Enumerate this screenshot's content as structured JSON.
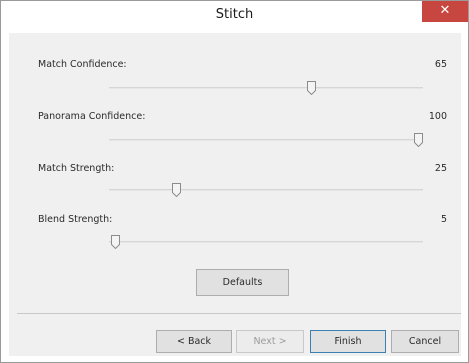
{
  "window": {
    "title": "Stitch",
    "close_glyph": "✕"
  },
  "sliders": [
    {
      "label": "Match Confidence:",
      "value": "65",
      "min": 0,
      "max": 100,
      "level": 65
    },
    {
      "label": "Panorama Confidence:",
      "value": "100",
      "min": 0,
      "max": 100,
      "level": 100
    },
    {
      "label": "Match Strength:",
      "value": "25",
      "min": 0,
      "max": 100,
      "level": 25
    },
    {
      "label": "Blend Strength:",
      "value": "5",
      "min": 0,
      "max": 100,
      "level": 5
    }
  ],
  "buttons": {
    "defaults": "Defaults",
    "back": "< Back",
    "next": "Next >",
    "finish": "Finish",
    "cancel": "Cancel"
  },
  "colors": {
    "close_button": "#c7463f",
    "dialog_background": "#f0f0f0"
  },
  "icons": {
    "close": "close-icon",
    "slider_thumb": "slider-thumb-icon"
  }
}
